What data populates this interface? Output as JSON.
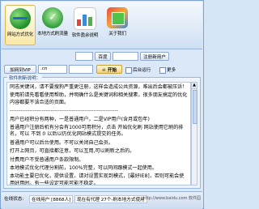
{
  "toolbar": {
    "items": [
      {
        "label": "网站方式优化",
        "icon": "globe-icon",
        "active": true
      },
      {
        "label": "本地方式刷流量",
        "icon": "people-check-icon",
        "active": false
      },
      {
        "label": "软件盈余说明",
        "icon": "chart-icon",
        "active": false
      },
      {
        "label": "关于我们",
        "icon": "box-icon",
        "active": false
      }
    ]
  },
  "controls": {
    "row1": {
      "field1": "",
      "button_label": "百度",
      "keyword_field": "",
      "register_button": "注册新用户"
    },
    "row2": {
      "add_vip_button": "加网到VIP",
      "port_field": ".cn",
      "url_field": "",
      "start_button": "☠ 开始",
      "checkbox1_label": "后台运行",
      "checkbox2_label": "更多"
    },
    "row3": {
      "use_help_button": "使用帮助",
      "checkbox_label": "自动刷新",
      "open_button": "打开使用搜狗000产品"
    }
  },
  "group": {
    "title": "软件刷新说明：",
    "paragraphs": [
      "同志关键词，请不要搜狗严重更注册，这样会造成公共资源，难出后会都被压诉！",
      "使用前请先看看使用帮助，并明确什么是关键词和相关搜素，很多朋友搞定的优化内容都要不该合适的页面。",
      "-------------------------------------------------------------",
      "用户已经积分有两种，一是普通用户，二是VIP用户(含月或包年)",
      "普通用户注册后机有分会有1000可用积分，点击 开始优化刷 网站使用它刷的排名，可以 不到 0 以后以仍优化网站模式提交的任务。",
      "普通用户可以后台使用。不可以关闭自己会员。",
      "打开上网页，可直接都注意，可以互用,可以刷新之后的。",
      "付费用户不受普通用户条款限制。",
      "本地模式优化代理分割前，100%完整，可以同间跟模式一起使用。",
      "本功能主要已优化，提供设置，请对设置实现到模式，[最好IE8]，否则可能会使用好用时。有一些设定可能可能不稳定。"
    ]
  },
  "status": {
    "left_label": "在线状态:",
    "left_value": "在线用户 [8868人]",
    "center_text": "现在有代理 27个-刷本地方式使用",
    "watermark": "http://www.baidu.com 软件园"
  }
}
